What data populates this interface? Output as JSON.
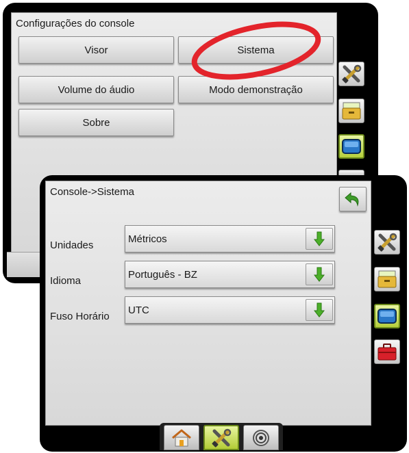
{
  "console_settings": {
    "title": "Configurações do console",
    "buttons": {
      "display": "Visor",
      "system": "Sistema",
      "audio_volume": "Volume do áudio",
      "demo_mode": "Modo demonstração",
      "about": "Sobre"
    }
  },
  "system_settings": {
    "title": "Console->Sistema",
    "units": {
      "label": "Unidades",
      "value": "Métricos"
    },
    "language": {
      "label": "Idioma",
      "value": "Português - BZ"
    },
    "timezone": {
      "label": "Fuso Horário",
      "value": "UTC"
    }
  },
  "side_tabs": [
    "tools-icon",
    "data-drawer-icon",
    "console-display-icon",
    "toolbox-icon"
  ],
  "bottom_tabs": [
    "home-icon",
    "tools-icon",
    "gnss-icon"
  ],
  "colors": {
    "highlight_ellipse": "#e3242b",
    "active_tab": "#b6cf3c",
    "arrow_green": "#4caf2a",
    "back_arrow": "#3f9c2a"
  }
}
